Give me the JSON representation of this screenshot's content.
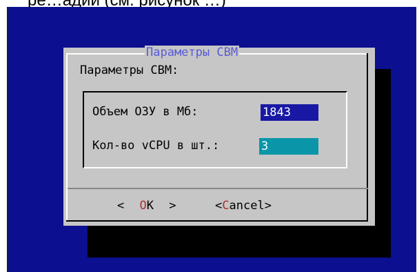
{
  "top_text": "ре…адии (см. рисунок …)",
  "dialog": {
    "title": "Параметры СВМ",
    "subtitle": "Параметры СВМ:",
    "ram_label": "Объем ОЗУ в Мб:",
    "ram_value": "1843",
    "cpu_label": "Кол-во vCPU в шт.:",
    "cpu_value": "3"
  },
  "buttons": {
    "ok": {
      "left": "<",
      "hot": "O",
      "rest": "K",
      "right": ">"
    },
    "cancel": {
      "left": "<",
      "hot": "C",
      "rest": "ancel",
      "right": ">"
    }
  },
  "colors": {
    "screen_bg": "#0c0f8f",
    "dialog_bg": "#c6c6c6",
    "title": "#5a5ad8",
    "field_active": "#1818a4",
    "field_focus": "#0a96a8",
    "hotkey": "#b03030"
  }
}
